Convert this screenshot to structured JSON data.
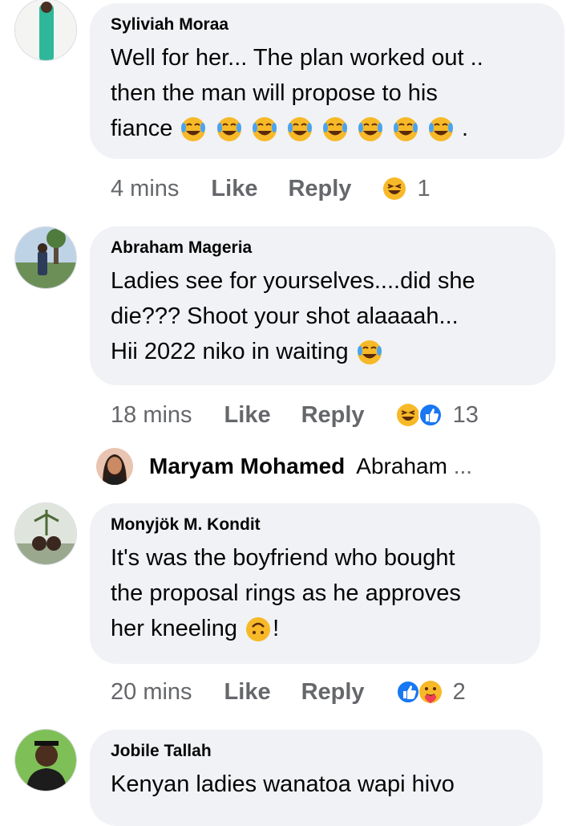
{
  "comments": [
    {
      "author": "Syliviah Moraa",
      "lines": [
        "Well for her... The plan worked out ..",
        "then the man will propose to his",
        "fiance"
      ],
      "trailing": ".",
      "emoji_icon": "tears-of-joy-emoji",
      "emoji_count": 8,
      "time": "4 mins",
      "like": "Like",
      "reply": "Reply",
      "reaction_icons": [
        "laughing-emoji"
      ],
      "reaction_count": "1"
    },
    {
      "author": "Abraham Mageria",
      "lines": [
        "Ladies see for yourselves....did she",
        "die???  Shoot your shot alaaaah...",
        "Hii 2022 niko in waiting"
      ],
      "emoji_icon": "tears-of-joy-emoji",
      "emoji_count": 1,
      "time": "18 mins",
      "like": "Like",
      "reply": "Reply",
      "reaction_icons": [
        "laughing-emoji",
        "like-icon"
      ],
      "reaction_count": "13"
    },
    {
      "author": "Monyjök M. Kondit",
      "lines": [
        "It's was the boyfriend who bought",
        "the proposal rings as he approves",
        "her kneeling"
      ],
      "trailing": "!",
      "emoji_icon": "upside-down-face-emoji",
      "emoji_count": 1,
      "time": "20 mins",
      "like": "Like",
      "reply": "Reply",
      "reaction_icons": [
        "like-icon",
        "care-emoji"
      ],
      "reaction_count": "2"
    },
    {
      "author": "Jobile Tallah",
      "lines": [
        "Kenyan ladies wanatoa wapi hivo"
      ]
    }
  ],
  "reply_preview": {
    "author": "Maryam Mohamed",
    "text": "Abraham",
    "ellipsis": "..."
  },
  "colors": {
    "bubble": "#f0f2f5",
    "meta_text": "#65676b",
    "like_blue": "#1877f2",
    "emoji_yellow": "#f7b928"
  }
}
